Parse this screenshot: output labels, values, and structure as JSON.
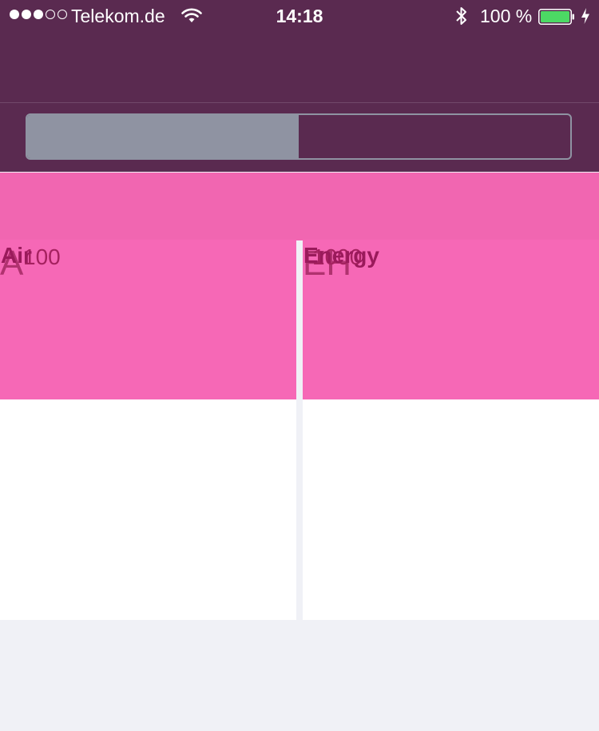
{
  "status_bar": {
    "carrier": "Telekom.de",
    "time": "14:18",
    "battery_percent": "100 %",
    "signal_bars_filled": 3,
    "signal_bars_total": 5
  },
  "segmented_control": {
    "segments": [
      "",
      ""
    ],
    "selected_index": 0
  },
  "tiles": [
    {
      "label": "Air",
      "value": "100",
      "symbol": "A"
    },
    {
      "label": "Energy",
      "value": "1000",
      "symbol": "EH"
    }
  ],
  "colors": {
    "header": "#5a2a50",
    "pink": "#f668b6",
    "segment_selected": "#8f93a2",
    "battery_fill": "#4cd964"
  }
}
